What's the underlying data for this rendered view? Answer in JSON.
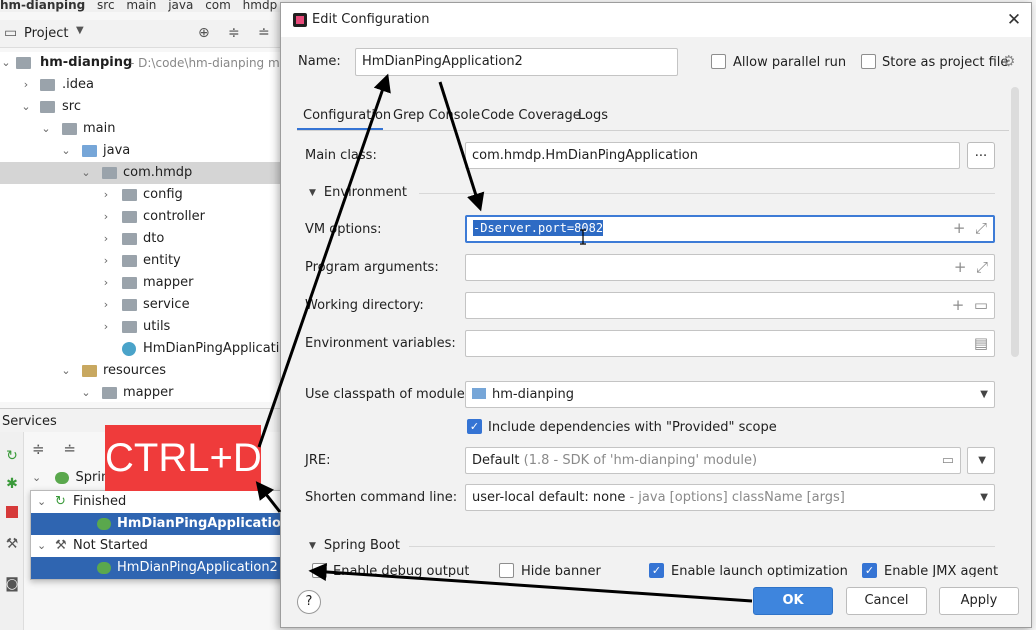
{
  "ide": {
    "breadcrumb": [
      "hm-dianping",
      "src",
      "main",
      "java",
      "com",
      "hmdp"
    ],
    "project_label": "Project",
    "tree": [
      {
        "label": "hm-dianping",
        "path": "- D:\\code\\hm-dianping m",
        "bold": true
      },
      {
        "label": ".idea"
      },
      {
        "label": "src"
      },
      {
        "label": "main"
      },
      {
        "label": "java"
      },
      {
        "label": "com.hmdp"
      },
      {
        "label": "config"
      },
      {
        "label": "controller"
      },
      {
        "label": "dto"
      },
      {
        "label": "entity"
      },
      {
        "label": "mapper"
      },
      {
        "label": "service"
      },
      {
        "label": "utils"
      },
      {
        "label": "HmDianPingApplication"
      },
      {
        "label": "resources"
      },
      {
        "label": "mapper"
      }
    ],
    "services_label": "Services",
    "services_root": "Sprin",
    "services": [
      {
        "label": "Finished"
      },
      {
        "label": "HmDianPingApplication"
      },
      {
        "label": "Not Started"
      },
      {
        "label": "HmDianPingApplication2"
      }
    ]
  },
  "overlay": {
    "text": "CTRL+D",
    "color": "#ef3b3b"
  },
  "dialog": {
    "title": "Edit Configuration",
    "name_label": "Name:",
    "name_value": "HmDianPingApplication2",
    "allow_parallel": "Allow parallel run",
    "store_as_file": "Store as project file",
    "tabs": [
      "Configuration",
      "Grep Console",
      "Code Coverage",
      "Logs"
    ],
    "main_class_label": "Main class:",
    "main_class_value": "com.hmdp.HmDianPingApplication",
    "browse_label": "...",
    "environment_label": "Environment",
    "vm_options_label": "VM options:",
    "vm_options_value": "-Dserver.port=8082",
    "program_args_label": "Program arguments:",
    "working_dir_label": "Working directory:",
    "env_vars_label": "Environment variables:",
    "classpath_label": "Use classpath of module:",
    "classpath_value": "hm-dianping",
    "include_deps_label": "Include dependencies with \"Provided\" scope",
    "jre_label": "JRE:",
    "jre_value": "Default",
    "jre_hint": "(1.8 - SDK of 'hm-dianping' module)",
    "shorten_label": "Shorten command line:",
    "shorten_value": "user-local default: none",
    "shorten_hint": "- java [options] className [args]",
    "spring_boot_label": "Spring Boot",
    "enable_debug": "Enable debug output",
    "hide_banner": "Hide banner",
    "enable_launch_opt": "Enable launch optimization",
    "enable_jmx": "Enable JMX agent",
    "ok_label": "OK",
    "cancel_label": "Cancel",
    "apply_label": "Apply",
    "help_label": "?"
  },
  "colors": {
    "accent": "#3574d4",
    "selection": "#2f65b1",
    "overlay": "#ef3b3b"
  }
}
